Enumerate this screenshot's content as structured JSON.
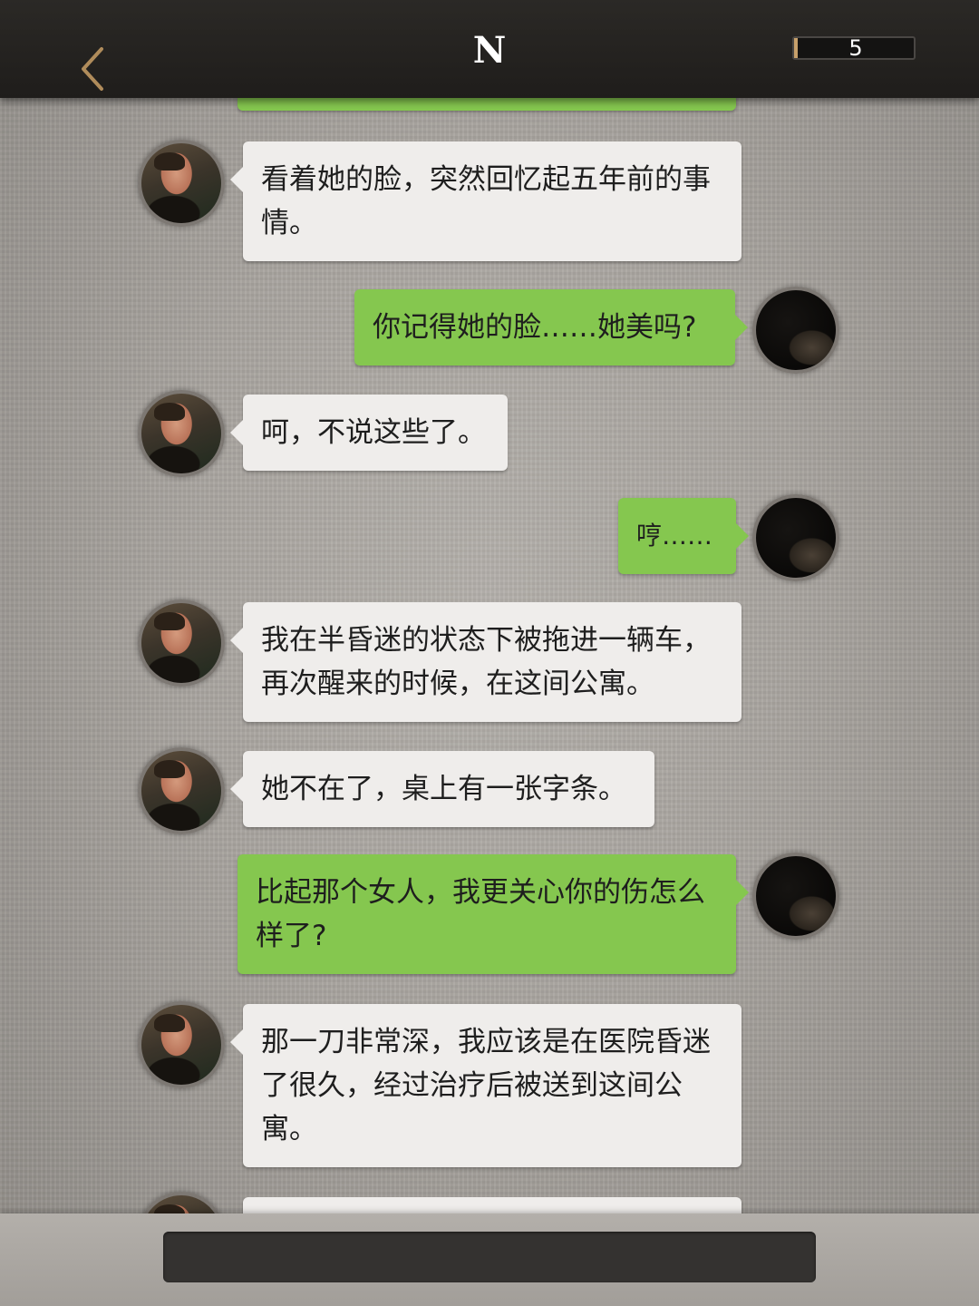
{
  "header": {
    "title": "N",
    "back_icon": "chevron-left-icon",
    "counter_value": "5",
    "accent_color": "#c7a06b"
  },
  "colors": {
    "incoming_bubble": "#efedeb",
    "outgoing_bubble": "#85c74f",
    "header_bg": "#232120"
  },
  "messages": [
    {
      "side": "left",
      "text": "看着她的脸，突然回忆起五年前的事情。"
    },
    {
      "side": "right",
      "text": "你记得她的脸……她美吗?"
    },
    {
      "side": "left",
      "text": "呵，不说这些了。"
    },
    {
      "side": "right",
      "text": "哼……"
    },
    {
      "side": "left",
      "text": "我在半昏迷的状态下被拖进一辆车，再次醒来的时候，在这间公寓。"
    },
    {
      "side": "left",
      "text": "她不在了，桌上有一张字条。"
    },
    {
      "side": "right",
      "text": "比起那个女人，我更关心你的伤怎么样了?"
    },
    {
      "side": "left",
      "text": "那一刀非常深，我应该是在医院昏迷了很久，经过治疗后被送到这间公寓。"
    },
    {
      "side": "left",
      "text": ""
    }
  ],
  "input": {
    "placeholder": ""
  }
}
